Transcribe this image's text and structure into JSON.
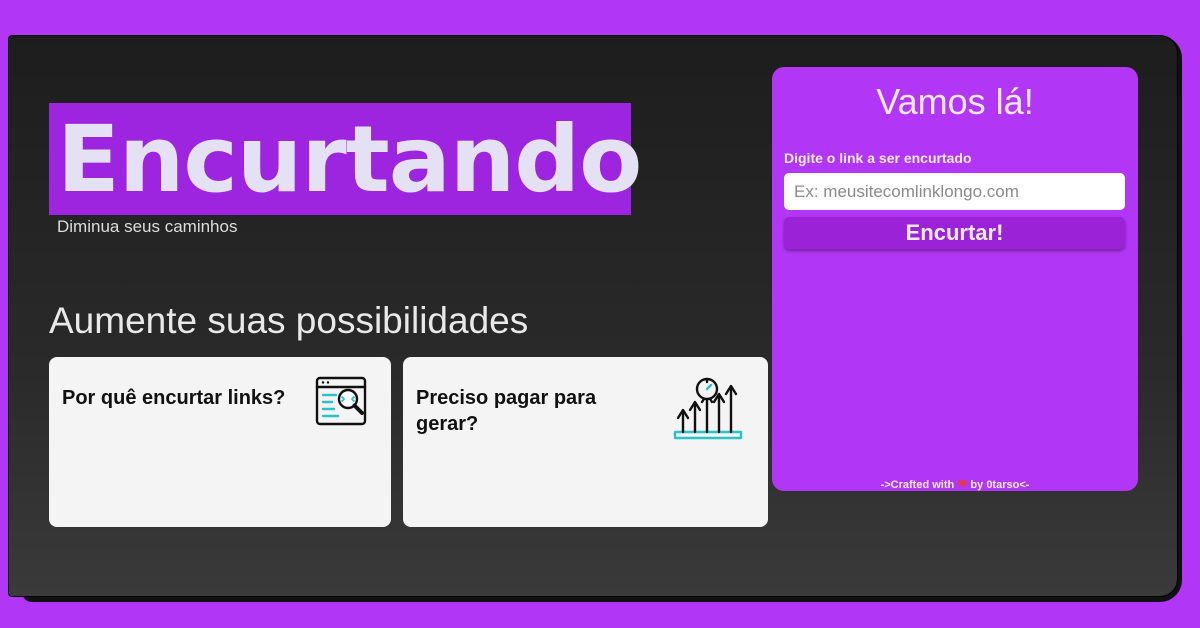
{
  "hero": {
    "title": "Encurtando",
    "subtitle": "Diminua seus caminhos"
  },
  "features": {
    "section_title": "Aumente suas possibilidades",
    "cards": [
      {
        "title": "Por quê encurtar links?",
        "icon": "code-search-icon"
      },
      {
        "title": "Preciso pagar para gerar?",
        "icon": "growth-chart-icon"
      }
    ]
  },
  "shortener": {
    "title": "Vamos lá!",
    "field_label": "Digite o link a ser encurtado",
    "input_value": "",
    "input_placeholder": "Ex: meusitecomlinklongo.com",
    "button_label": "Encurtar!",
    "credit_prefix": "->Crafted with",
    "credit_suffix": "by 0tarso<-"
  },
  "colors": {
    "background": "#b236f5",
    "brand_block": "#9d25e0",
    "panel": "#b236f5",
    "button": "#9b22d6",
    "card": "#f4f4f4",
    "icon_accent": "#29c3c8"
  }
}
